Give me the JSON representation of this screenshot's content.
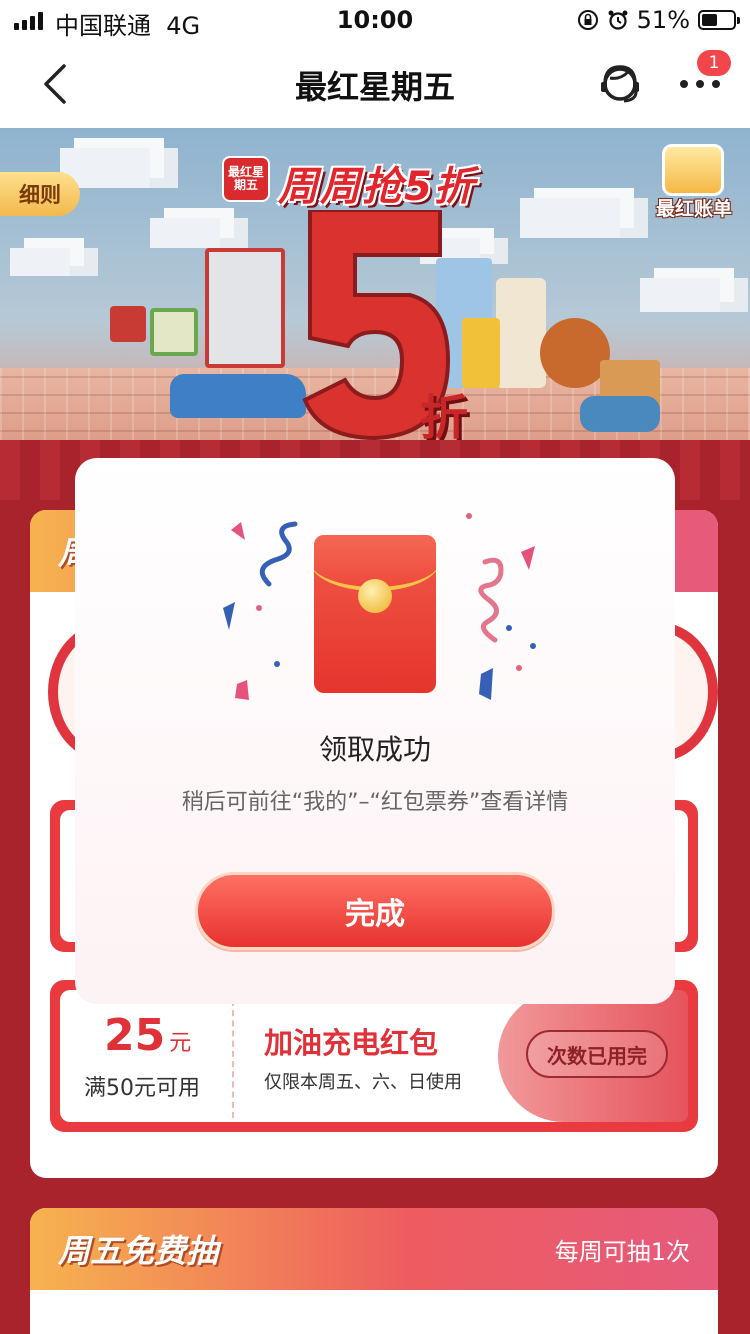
{
  "status_bar": {
    "carrier": "中国联通",
    "network": "4G",
    "time": "10:00",
    "battery": "51%",
    "battery_level": 0.51
  },
  "nav": {
    "title": "最红星期五",
    "badge_count": "1"
  },
  "hero": {
    "rules_tag": "细则",
    "logo_text": "最红星期五",
    "headline": "周周抢5折",
    "ledger_label": "最红账单",
    "five": "5",
    "zhe": "折"
  },
  "background_cards": {
    "first_card_title_fragment": "周",
    "coupon": {
      "amount": "25",
      "unit": "元",
      "condition": "满50元可用",
      "title": "加油充电红包",
      "desc": "仅限本周五、六、日使用",
      "button": "次数已用完"
    },
    "draw_card": {
      "title": "周五免费抽",
      "note": "每周可抽1次"
    }
  },
  "modal": {
    "title": "领取成功",
    "subtitle": "稍后可前往“我的”–“红包票券”查看详情",
    "done_button": "完成"
  },
  "colors": {
    "accent_red": "#e7322f",
    "badge_red": "#f2464c",
    "page_bg": "#a8232b"
  },
  "icons": [
    "back-icon",
    "customer-service-icon",
    "more-icon",
    "red-envelope-icon",
    "ledger-icon"
  ]
}
